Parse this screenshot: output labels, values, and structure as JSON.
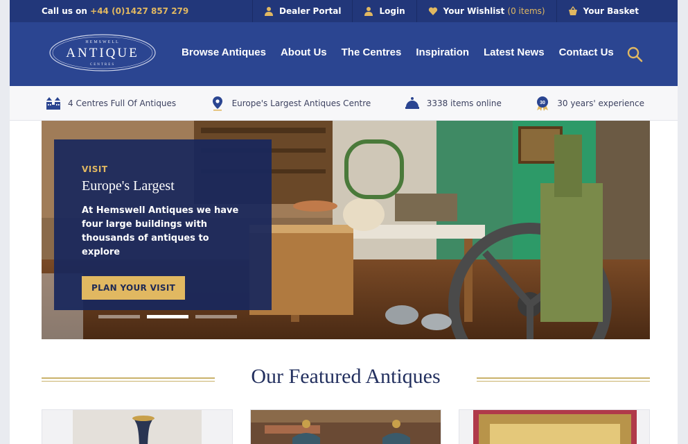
{
  "topbar": {
    "call_prefix": "Call us on",
    "phone": "+44 (0)1427 857 279",
    "dealer_portal": "Dealer Portal",
    "login": "Login",
    "wishlist_label": "Your Wishlist",
    "wishlist_count": "(0 items)",
    "basket": "Your Basket"
  },
  "logo": {
    "top": "HEMSWELL",
    "main": "ANTIQUE",
    "bottom": "CENTRES"
  },
  "nav": [
    {
      "label": "Browse Antiques"
    },
    {
      "label": "About Us"
    },
    {
      "label": "The Centres"
    },
    {
      "label": "Inspiration"
    },
    {
      "label": "Latest News"
    },
    {
      "label": "Contact Us"
    }
  ],
  "usp": [
    {
      "label": "4 Centres Full Of Antiques",
      "icon": "buildings-icon"
    },
    {
      "label": "Europe's Largest Antiques Centre",
      "icon": "location-pin-icon"
    },
    {
      "label": "3338 items online",
      "icon": "cloche-icon"
    },
    {
      "label": "30 years' experience",
      "icon": "award-badge-icon"
    }
  ],
  "badge_number": "30",
  "hero": {
    "eyebrow": "VISIT",
    "title": "Europe's Largest",
    "text": "At Hemswell Antiques we have four large buildings with thousands of antiques to explore",
    "button": "PLAN YOUR VISIT"
  },
  "featured": {
    "heading": "Our Featured Antiques"
  },
  "colors": {
    "brand_navy": "#2b4591",
    "topbar_navy": "#22377a",
    "gold": "#e1b861"
  }
}
